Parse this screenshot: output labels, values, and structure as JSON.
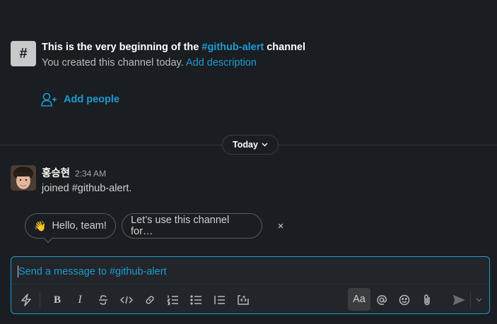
{
  "intro": {
    "hash_symbol": "#",
    "title_prefix": "This is the very beginning of the ",
    "channel_link": "#github-alert",
    "title_suffix": " channel",
    "sub_text": "You created this channel today. ",
    "add_description": "Add description"
  },
  "add_people": {
    "label": "Add people",
    "icon": "add-person-icon"
  },
  "divider": {
    "date_label": "Today",
    "icon": "chevron-down-icon"
  },
  "message": {
    "author": "홍승현",
    "time": "2:34 AM",
    "text": "joined #github-alert."
  },
  "suggestions": {
    "chip1_emoji": "👋",
    "chip1_label": "Hello, team!",
    "chip2_label": "Let’s use this channel for…",
    "close": "×"
  },
  "composer": {
    "placeholder": "Send a message to #github-alert",
    "format_toggle": "Aa",
    "icons": [
      "shortcuts-icon",
      "bold-icon",
      "italic-icon",
      "strikethrough-icon",
      "code-icon",
      "link-icon",
      "ordered-list-icon",
      "bulleted-list-icon",
      "blockquote-icon",
      "code-block-icon",
      "mention-icon",
      "emoji-icon",
      "attachment-icon",
      "send-icon",
      "send-options-icon"
    ]
  },
  "colors": {
    "accent": "#1d9bd1",
    "background": "#1a1d21",
    "composer_bg": "#222529"
  }
}
